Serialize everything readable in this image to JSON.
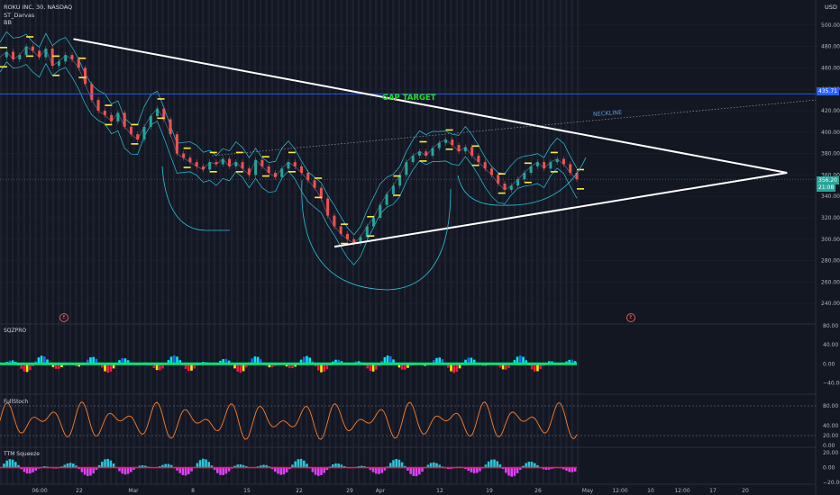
{
  "header": {
    "symbol": "ROKU INC, 30, NASDAQ",
    "indicator1": "ST_Darvas",
    "indicator2": "BB",
    "currency": "USD"
  },
  "annotations": {
    "gap_target": "GAP TARGET",
    "neckline": "NECKLINE",
    "earnings_marker": "E"
  },
  "price_tags": {
    "gap": "435.71",
    "last": "356.20",
    "countdown": "21:08"
  },
  "panes": {
    "sqz": "SQZPRO",
    "stoch": "FullStoch",
    "ttm": "TTM Squeeze"
  },
  "colors": {
    "background": "#131722",
    "candle_up": "#26a69a",
    "candle_down": "#ef5350",
    "darvas": "#ffeb3b",
    "bands": "#26c6da",
    "trendline": "#ffffff",
    "gap_text": "#22dd22",
    "neckline": "#5b9bd5",
    "stoch": "#ff7f27",
    "current_tag": "#26a69a",
    "gap_tag": "#2962ff"
  },
  "chart_data": {
    "type": "line",
    "title": "ROKU INC, 30, NASDAQ",
    "xlabel": "",
    "ylabel": "",
    "ylim": [
      225,
      515
    ],
    "grid": true,
    "x_ticks": [
      "06:00",
      "22",
      "Mar",
      "8",
      "15",
      "22",
      "29",
      "Apr",
      "12",
      "19",
      "26",
      "May",
      "12:00",
      "10",
      "12:00",
      "17",
      "20"
    ],
    "y_ticks": [
      "500.00",
      "480.00",
      "460.00",
      "440.00",
      "420.00",
      "400.00",
      "380.00",
      "360.00",
      "340.00",
      "320.00",
      "300.00",
      "280.00",
      "260.00",
      "240.00"
    ],
    "series": [
      {
        "values": [
          470,
          475,
          468,
          472,
          480,
          476,
          470,
          478,
          462,
          466,
          472,
          468,
          460,
          445,
          430,
          420,
          416,
          410,
          418,
          405,
          398,
          393,
          405,
          415,
          422,
          412,
          398,
          380,
          376,
          372,
          368,
          365,
          372,
          370,
          375,
          368,
          372,
          366,
          360,
          374,
          368,
          362,
          358,
          366,
          372,
          368,
          362,
          355,
          348,
          338,
          322,
          312,
          305,
          300,
          296,
          302,
          312,
          320,
          332,
          342,
          350,
          360,
          372,
          378,
          382,
          378,
          385,
          390,
          393,
          388,
          382,
          386,
          378,
          372,
          366,
          360,
          352,
          346,
          350,
          356,
          362,
          368,
          372,
          366,
          372,
          375,
          370,
          362,
          356
        ]
      }
    ],
    "pattern": {
      "upper_trendline": [
        [
          0.09,
          487
        ],
        [
          0.965,
          362
        ]
      ],
      "lower_trendline": [
        [
          0.41,
          293
        ],
        [
          0.965,
          362
        ]
      ],
      "neckline": [
        [
          0.26,
          378
        ],
        [
          1.0,
          430
        ]
      ],
      "gap_level": 435.71
    },
    "oscillators": {
      "sqzpro_ylim": [
        -60,
        80
      ],
      "sqzpro_ticks": [
        "80.00",
        "40.00",
        "0.00",
        "−40.00"
      ],
      "stoch_ylim": [
        0,
        100
      ],
      "stoch_ticks": [
        "80.00",
        "40.00",
        "20.00",
        "0.00"
      ],
      "ttm_ylim": [
        -20,
        25
      ],
      "ttm_ticks": [
        "20.00",
        "0.00",
        "−20.00"
      ]
    }
  }
}
